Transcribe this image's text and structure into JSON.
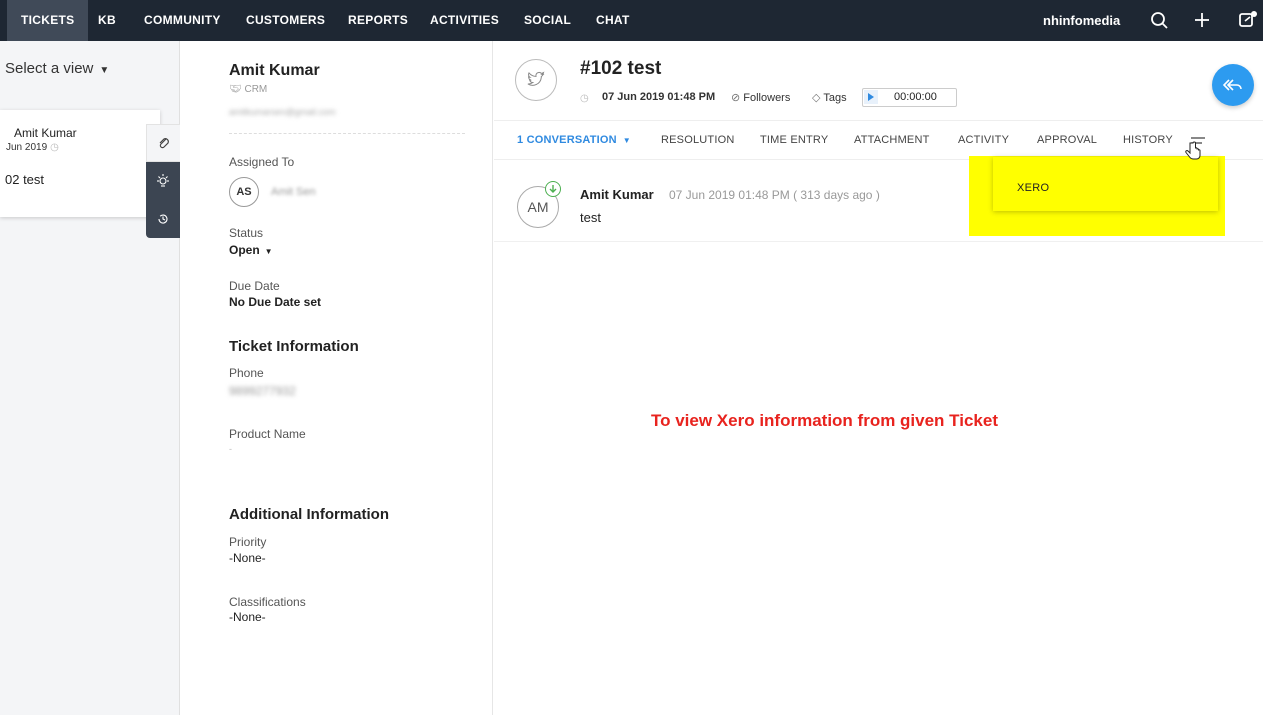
{
  "nav": {
    "items": [
      {
        "label": "TICKETS",
        "active": true
      },
      {
        "label": "KB"
      },
      {
        "label": "COMMUNITY"
      },
      {
        "label": "CUSTOMERS"
      },
      {
        "label": "REPORTS"
      },
      {
        "label": "ACTIVITIES"
      },
      {
        "label": "SOCIAL"
      },
      {
        "label": "CHAT"
      }
    ],
    "portal": "nhinfomedia",
    "icons": [
      "search-icon",
      "plus-icon",
      "external-icon"
    ],
    "bg_color": "#1e2733"
  },
  "list": {
    "select_view": "Select a view",
    "card": {
      "name": "Amit Kumar",
      "date": "Jun 2019",
      "subject": "02  test"
    }
  },
  "contact": {
    "name": "Amit Kumar",
    "source": "CRM",
    "email": "amitkumarsen@gmail.com"
  },
  "details": {
    "assigned_to_label": "Assigned To",
    "assignee_initials": "AS",
    "assignee_name": "Amit Sen",
    "status_label": "Status",
    "status_value": "Open",
    "due_date_label": "Due Date",
    "due_date_value": "No Due Date set",
    "ticket_info_heading": "Ticket Information",
    "phone_label": "Phone",
    "phone_value": "9899277932",
    "product_label": "Product Name",
    "product_value": "-",
    "additional_heading": "Additional Information",
    "priority_label": "Priority",
    "priority_value": "-None-",
    "classifications_label": "Classifications",
    "classifications_value": "-None-"
  },
  "ticket": {
    "title": "#102  test",
    "date": "07 Jun 2019 01:48 PM",
    "followers": "Followers",
    "tags": "Tags",
    "timer": "00:00:00"
  },
  "tabs": {
    "conversation": "1 CONVERSATION",
    "resolution": "RESOLUTION",
    "time_entry": "TIME ENTRY",
    "attachment": "ATTACHMENT",
    "activity": "ACTIVITY",
    "approval": "APPROVAL",
    "history": "HISTORY",
    "active_color": "#2f8ae0"
  },
  "menu": {
    "xero": "XERO",
    "highlight_color": "#ffff00"
  },
  "conversation": {
    "avatar": "AM",
    "author": "Amit Kumar",
    "date": "07 Jun 2019 01:48 PM ( 313 days ago )",
    "text": "test"
  },
  "annotation": {
    "text": "To view Xero information from given Ticket",
    "color": "#e8231e"
  },
  "accent": {
    "reply_button": "#2d9bf0"
  }
}
